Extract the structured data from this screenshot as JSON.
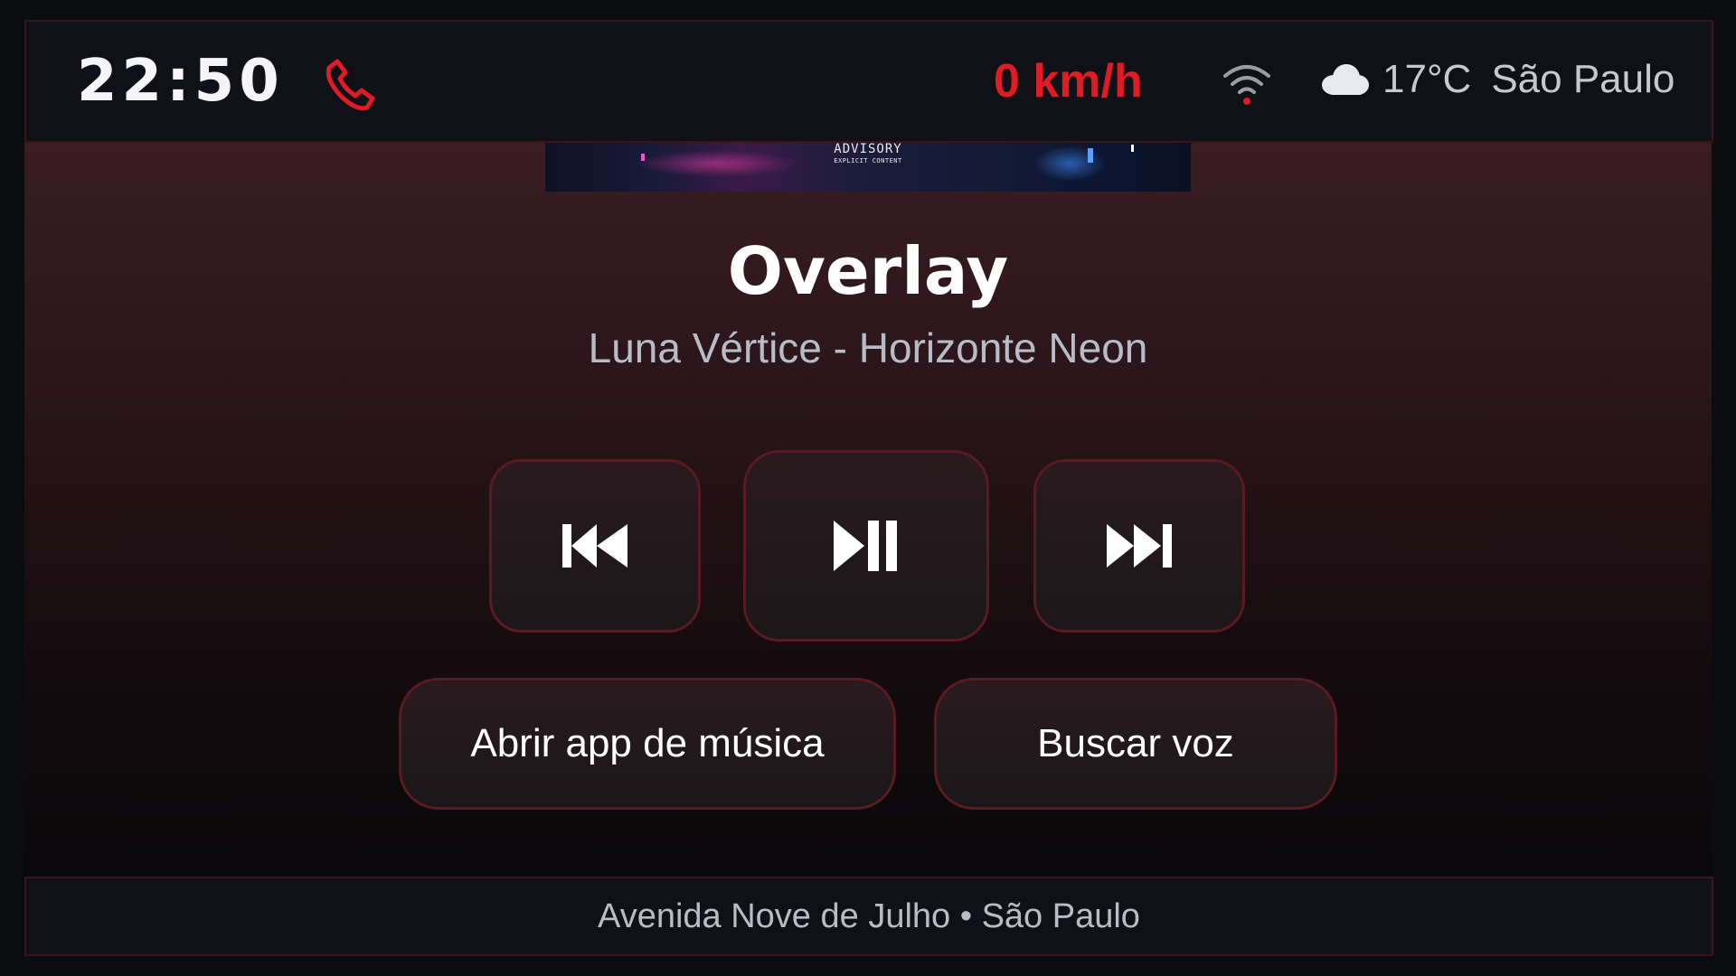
{
  "status_bar": {
    "time": "22:50",
    "speed": "0 km/h",
    "temperature": "17°C",
    "city": "São Paulo",
    "icons": [
      "phone-icon",
      "wifi-icon",
      "cloud-icon"
    ],
    "accent_color": "#e01b26"
  },
  "album_art": {
    "advisory": "ADVISORY",
    "advisory_sub": "EXPLICIT CONTENT"
  },
  "now_playing": {
    "title": "Overlay",
    "subtitle": "Luna Vértice - Horizonte Neon"
  },
  "controls": {
    "icons": [
      "previous-track-icon",
      "play-pause-icon",
      "next-track-icon"
    ]
  },
  "actions": {
    "open_music_app": "Abrir app de música",
    "voice_search": "Buscar voz"
  },
  "location_bar": {
    "text": "Avenida Nove de Julho • São Paulo"
  },
  "colors": {
    "border": "#5a1a21",
    "bar_background": "#101116"
  }
}
